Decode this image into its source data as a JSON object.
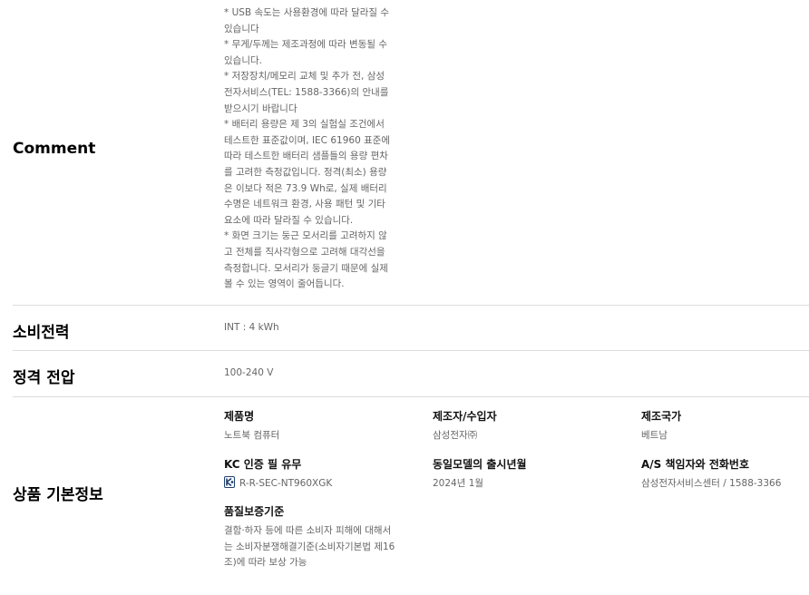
{
  "comment": {
    "title": "Comment",
    "notes": [
      "* USB 속도는 사용환경에 따라 달라질 수 있습니다",
      "* 무게/두께는 제조과정에 따라 변동될 수 있습니다.",
      "* 저장장치/메모리 교체 및 추가 전, 삼성전자서비스(TEL: 1588-3366)의 안내를 받으시기 바랍니다",
      "* 배터리 용량은 제 3의 실험실 조건에서 테스트한 표준값이며, IEC 61960 표준에 따라 테스트한 배터리 샘플들의 용량 편차를 고려한 측정값입니다. 정격(최소) 용량은 이보다 적은 73.9 Wh로, 실제 배터리 수명은 네트워크 환경, 사용 패턴 및 기타 요소에 따라 달라질 수 있습니다.",
      "* 화면 크기는 둥근 모서리를 고려하지 않고 전체를 직사각형으로 고려해 대각선을 측정합니다. 모서리가 둥글기 때문에 실제 볼 수 있는 영역이 줄어듭니다."
    ]
  },
  "power": {
    "title": "소비전력",
    "value": "INT : 4 kWh"
  },
  "voltage": {
    "title": "정격 전압",
    "value": "100-240 V"
  },
  "product_info": {
    "title": "상품 기본정보",
    "product_name": {
      "label": "제품명",
      "value": "노트북 컴퓨터"
    },
    "manufacturer": {
      "label": "제조자/수입자",
      "value": "삼성전자㈜"
    },
    "country": {
      "label": "제조국가",
      "value": "베트남"
    },
    "kc": {
      "label": "KC 인증 필 유무",
      "value": "R-R-SEC-NT960XGK"
    },
    "release": {
      "label": "동일모델의 출시년월",
      "value": "2024년 1월"
    },
    "as": {
      "label": "A/S 책임자와 전화번호",
      "value": "삼성전자서비스센터 / 1588-3366"
    },
    "warranty": {
      "label": "품질보증기준",
      "value": "결함·하자 등에 따른 소비자 피해에 대해서는 소비자분쟁해결기준(소비자기본법 제16조)에 따라 보상 가능"
    }
  }
}
